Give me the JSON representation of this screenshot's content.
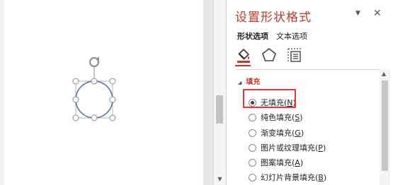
{
  "panel": {
    "title": "设置形状格式",
    "dropdown_icon": "chevron-down-icon",
    "close_icon": "close-icon",
    "subtabs": [
      "形状选项",
      "文本选项"
    ],
    "category_icons": [
      "fill-bucket-icon",
      "pentagon-icon",
      "size-properties-icon"
    ],
    "section": {
      "title": "填充",
      "expanded": true
    },
    "options": [
      {
        "label": "无填充(",
        "key": "N",
        "suffix": ")",
        "checked": true
      },
      {
        "label": "纯色填充(",
        "key": "S",
        "suffix": ")",
        "checked": false
      },
      {
        "label": "渐变填充(",
        "key": "G",
        "suffix": ")",
        "checked": false
      },
      {
        "label": "图片或纹理填充(",
        "key": "P",
        "suffix": ")",
        "checked": false
      },
      {
        "label": "图案填充(",
        "key": "A",
        "suffix": ")",
        "checked": false
      },
      {
        "label": "幻灯片背景填充(",
        "key": "B",
        "suffix": ")",
        "checked": false
      }
    ]
  },
  "colors": {
    "accent": "#c0392b",
    "highlight_box": "#e53935",
    "shape_outline": "#4a6fa5"
  }
}
